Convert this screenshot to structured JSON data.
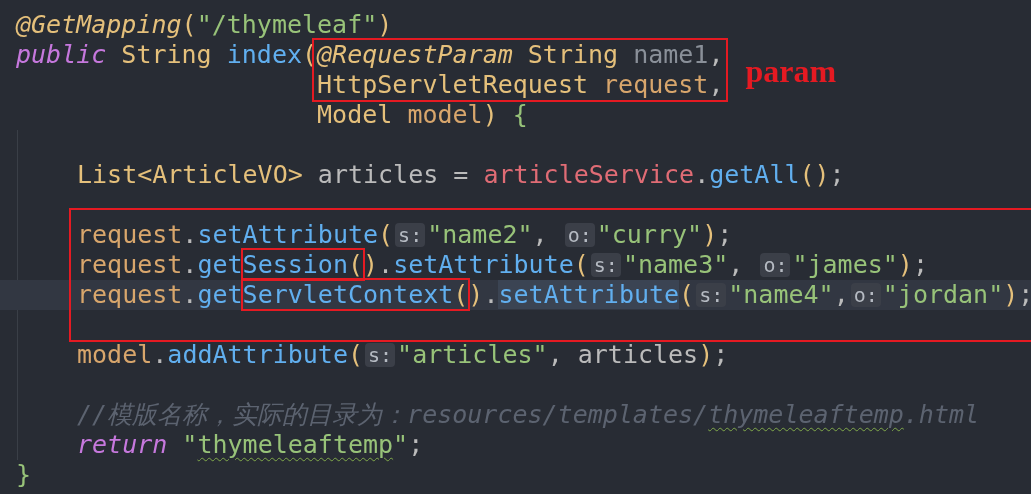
{
  "editor": {
    "lines": [
      {
        "kind": "line",
        "current": false,
        "tokens": [
          {
            "text": "@GetMapping",
            "kind": "annotation"
          },
          {
            "text": "(",
            "kind": "paren"
          },
          {
            "text": "\"/thymeleaf\"",
            "kind": "string"
          },
          {
            "text": ")",
            "kind": "paren"
          }
        ]
      },
      {
        "kind": "line",
        "current": false,
        "tokens": [
          {
            "text": "public",
            "kind": "keyword"
          },
          {
            "text": " String ",
            "kind": "type"
          },
          {
            "text": "index",
            "kind": "function"
          },
          {
            "text": "(",
            "kind": "paren"
          },
          {
            "kind": "aligned",
            "lines": [
              {
                "kind": "box",
                "note": "param",
                "lines": [
                  {
                    "kind": "line",
                    "current": false,
                    "tokens": [
                      {
                        "text": "@RequestParam",
                        "kind": "annotation"
                      },
                      {
                        "text": " String ",
                        "kind": "type"
                      },
                      {
                        "text": "name1",
                        "kind": "unused"
                      },
                      {
                        "text": ",",
                        "kind": "punct"
                      }
                    ]
                  },
                  {
                    "kind": "line",
                    "current": false,
                    "tokens": [
                      {
                        "text": "HttpServletRequest",
                        "kind": "type"
                      },
                      {
                        "text": " request",
                        "kind": "variable"
                      },
                      {
                        "text": ",",
                        "kind": "punct"
                      }
                    ]
                  }
                ]
              },
              {
                "kind": "line",
                "current": false,
                "tokens": [
                  {
                    "text": "Model",
                    "kind": "type"
                  },
                  {
                    "text": " model",
                    "kind": "variable"
                  },
                  {
                    "text": ")",
                    "kind": "paren"
                  },
                  {
                    "text": " {",
                    "kind": "brace"
                  }
                ]
              }
            ]
          }
        ],
        "children": [
          {
            "kind": "blank"
          },
          {
            "kind": "line",
            "current": false,
            "tokens": [
              {
                "text": "List<ArticleVO>",
                "kind": "type"
              },
              {
                "text": " articles = ",
                "kind": "plain"
              },
              {
                "text": "articleService",
                "kind": "field"
              },
              {
                "text": ".",
                "kind": "punct"
              },
              {
                "text": "getAll",
                "kind": "function"
              },
              {
                "text": "()",
                "kind": "paren"
              },
              {
                "text": ";",
                "kind": "punct"
              }
            ]
          },
          {
            "kind": "blank"
          },
          {
            "kind": "box",
            "lines": [
              {
                "kind": "line",
                "current": false,
                "tokens": [
                  {
                    "text": "request",
                    "kind": "variable"
                  },
                  {
                    "text": ".",
                    "kind": "punct"
                  },
                  {
                    "text": "setAttribute",
                    "kind": "function"
                  },
                  {
                    "text": "(",
                    "kind": "paren"
                  },
                  {
                    "text": "s:",
                    "kind": "hint"
                  },
                  {
                    "text": "\"name2\"",
                    "kind": "string"
                  },
                  {
                    "text": ", ",
                    "kind": "punct"
                  },
                  {
                    "text": "o:",
                    "kind": "hint"
                  },
                  {
                    "text": "\"curry\"",
                    "kind": "string"
                  },
                  {
                    "text": ")",
                    "kind": "paren"
                  },
                  {
                    "text": ";",
                    "kind": "punct"
                  }
                ]
              },
              {
                "kind": "line",
                "current": false,
                "tokens": [
                  {
                    "text": "request",
                    "kind": "variable"
                  },
                  {
                    "text": ".",
                    "kind": "punct"
                  },
                  {
                    "text": "get",
                    "kind": "function"
                  },
                  {
                    "kind": "box",
                    "tokens": [
                      {
                        "text": "Session",
                        "kind": "function"
                      },
                      {
                        "text": "(",
                        "kind": "paren"
                      }
                    ]
                  },
                  {
                    "text": ")",
                    "kind": "paren"
                  },
                  {
                    "text": ".",
                    "kind": "punct"
                  },
                  {
                    "text": "setAttribute",
                    "kind": "function"
                  },
                  {
                    "text": "(",
                    "kind": "paren"
                  },
                  {
                    "text": "s:",
                    "kind": "hint"
                  },
                  {
                    "text": "\"name3\"",
                    "kind": "string"
                  },
                  {
                    "text": ", ",
                    "kind": "punct"
                  },
                  {
                    "text": "o:",
                    "kind": "hint"
                  },
                  {
                    "text": "\"james\"",
                    "kind": "string"
                  },
                  {
                    "text": ")",
                    "kind": "paren"
                  },
                  {
                    "text": ";",
                    "kind": "punct"
                  }
                ]
              },
              {
                "kind": "line",
                "current": true,
                "tokens": [
                  {
                    "text": "request",
                    "kind": "variable"
                  },
                  {
                    "text": ".",
                    "kind": "punct"
                  },
                  {
                    "text": "get",
                    "kind": "function"
                  },
                  {
                    "kind": "box",
                    "tokens": [
                      {
                        "text": "ServletContext",
                        "kind": "function"
                      },
                      {
                        "text": "(",
                        "kind": "paren"
                      }
                    ]
                  },
                  {
                    "text": ")",
                    "kind": "paren"
                  },
                  {
                    "text": ".",
                    "kind": "punct"
                  },
                  {
                    "text": "setAttribute",
                    "kind": "function_match"
                  },
                  {
                    "text": "(",
                    "kind": "paren"
                  },
                  {
                    "text": "s:",
                    "kind": "hint"
                  },
                  {
                    "text": "\"name4\"",
                    "kind": "string"
                  },
                  {
                    "text": ",",
                    "kind": "punct"
                  },
                  {
                    "text": "o:",
                    "kind": "hint"
                  },
                  {
                    "text": "\"jordan\"",
                    "kind": "string"
                  },
                  {
                    "text": ")",
                    "kind": "paren"
                  },
                  {
                    "text": ";",
                    "kind": "punct"
                  }
                ]
              },
              {
                "kind": "blank"
              }
            ]
          },
          {
            "kind": "line",
            "current": false,
            "tokens": [
              {
                "text": "model",
                "kind": "variable"
              },
              {
                "text": ".",
                "kind": "punct"
              },
              {
                "text": "addAttribute",
                "kind": "function"
              },
              {
                "text": "(",
                "kind": "paren"
              },
              {
                "text": "s:",
                "kind": "hint"
              },
              {
                "text": "\"articles\"",
                "kind": "string"
              },
              {
                "text": ", articles",
                "kind": "plain"
              },
              {
                "text": ")",
                "kind": "paren"
              },
              {
                "text": ";",
                "kind": "punct"
              }
            ]
          },
          {
            "kind": "blank"
          },
          {
            "kind": "line",
            "current": false,
            "tokens": [
              {
                "text": "//模版名称，实际的目录为：resources/templates/",
                "kind": "comment"
              },
              {
                "text": "thymeleaftemp",
                "kind": "comment_typo"
              },
              {
                "text": ".html",
                "kind": "comment"
              }
            ]
          },
          {
            "kind": "line",
            "current": false,
            "tokens": [
              {
                "text": "return",
                "kind": "keyword"
              },
              {
                "text": " \"",
                "kind": "string"
              },
              {
                "text": "thymeleaftemp",
                "kind": "string_typo"
              },
              {
                "text": "\"",
                "kind": "string"
              },
              {
                "text": ";",
                "kind": "punct"
              }
            ]
          }
        ]
      },
      {
        "kind": "line",
        "current": false,
        "tokens": [
          {
            "text": "}",
            "kind": "brace"
          }
        ]
      }
    ]
  }
}
